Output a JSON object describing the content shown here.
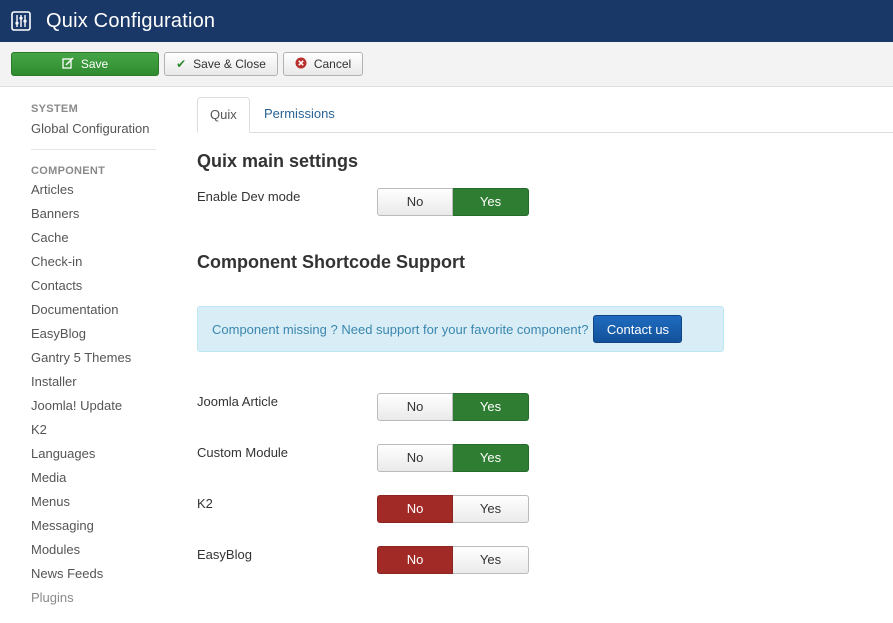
{
  "header": {
    "title": "Quix Configuration",
    "icon": "sliders-icon",
    "bg_color": "#1a3867"
  },
  "toolbar": {
    "save_label": "Save",
    "save_close_label": "Save & Close",
    "cancel_label": "Cancel"
  },
  "sidebar": {
    "system_heading": "SYSTEM",
    "global_config": "Global Configuration",
    "component_heading": "COMPONENT",
    "items": [
      "Articles",
      "Banners",
      "Cache",
      "Check-in",
      "Contacts",
      "Documentation",
      "EasyBlog",
      "Gantry 5 Themes",
      "Installer",
      "Joomla! Update",
      "K2",
      "Languages",
      "Media",
      "Menus",
      "Messaging",
      "Modules",
      "News Feeds",
      "Plugins"
    ]
  },
  "tabs": {
    "quix": "Quix",
    "permissions": "Permissions"
  },
  "main": {
    "section1_title": "Quix main settings",
    "dev_mode_label": "Enable Dev mode",
    "section2_title": "Component Shortcode Support",
    "alert_text": "Component missing ? Need support for your favorite component?",
    "contact_label": "Contact us",
    "settings": [
      {
        "label": "Joomla Article",
        "value": "Yes"
      },
      {
        "label": "Custom Module",
        "value": "Yes"
      },
      {
        "label": "K2",
        "value": "No"
      },
      {
        "label": "EasyBlog",
        "value": "No"
      }
    ],
    "dev_mode_value": "Yes",
    "no_label": "No",
    "yes_label": "Yes"
  },
  "colors": {
    "yes_active": "#2f7d32",
    "no_active": "#a12a27",
    "save_green": "#46a546",
    "alert_bg": "#d9edf7"
  }
}
